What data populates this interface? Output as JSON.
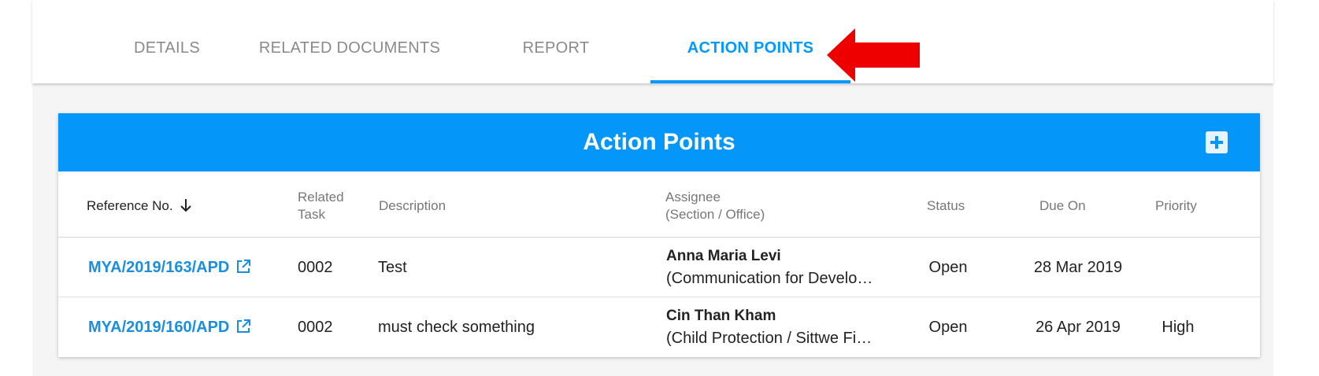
{
  "tabs": [
    {
      "label": "DETAILS"
    },
    {
      "label": "RELATED DOCUMENTS"
    },
    {
      "label": "REPORT"
    },
    {
      "label": "ACTION POINTS"
    }
  ],
  "active_tab": "ACTION POINTS",
  "card": {
    "title": "Action Points",
    "add_icon": "plus-square-icon"
  },
  "table": {
    "columns": {
      "reference": "Reference No.",
      "related_task_line1": "Related",
      "related_task_line2": "Task",
      "description": "Description",
      "assignee_line1": "Assignee",
      "assignee_line2": "(Section / Office)",
      "status": "Status",
      "due_on": "Due On",
      "priority": "Priority"
    },
    "rows": [
      {
        "reference": "MYA/2019/163/APD",
        "related_task": "0002",
        "description": "Test",
        "assignee_name": "Anna Maria Levi",
        "assignee_office": "(Communication for Develop…",
        "status": "Open",
        "due_on": "28 Mar 2019",
        "priority": ""
      },
      {
        "reference": "MYA/2019/160/APD",
        "related_task": "0002",
        "description": "must check something",
        "assignee_name": "Cin Than Kham",
        "assignee_office": "(Child Protection / Sittwe Fiel…",
        "status": "Open",
        "due_on": "26 Apr 2019",
        "priority": "High"
      }
    ]
  },
  "colors": {
    "accent": "#0099ff",
    "header_bg": "#0496f8",
    "link": "#1a8fe0",
    "arrow": "#ee0000"
  }
}
